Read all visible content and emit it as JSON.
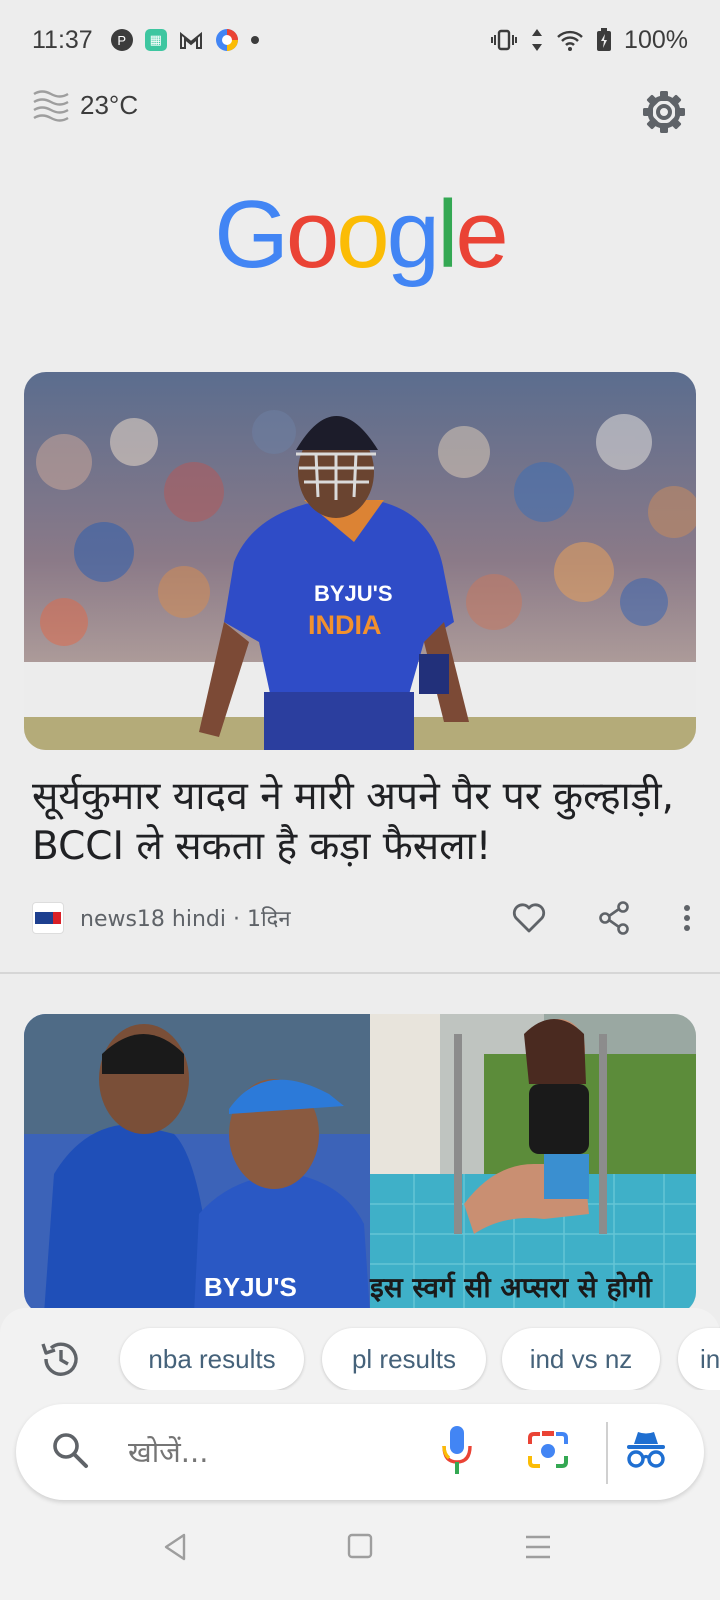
{
  "status_bar": {
    "time": "11:37",
    "battery": "100%"
  },
  "weather": {
    "temperature": "23°C"
  },
  "logo": {
    "letters": [
      "G",
      "o",
      "o",
      "g",
      "l",
      "e"
    ],
    "colors": [
      "#4285F4",
      "#EA4335",
      "#FBBC05",
      "#4285F4",
      "#34A853",
      "#EA4335"
    ]
  },
  "feed": {
    "card1": {
      "headline": "सूर्यकुमार यादव ने मारी अपने पैर पर कुल्हाड़ी, BCCI ले सकता है कड़ा फैसला!",
      "source": "news18 hindi · 1दिन",
      "image_text": {
        "jersey_sponsor": "BYJU'S",
        "jersey_country": "INDIA"
      }
    },
    "card2": {
      "caption": "इस स्वर्ग सी अप्सरा से होगी",
      "image_text": {
        "jersey_sponsor": "BYJU'S"
      }
    }
  },
  "suggestions": [
    "nba results",
    "pl results",
    "ind vs nz",
    "in"
  ],
  "search": {
    "placeholder": "खोजें..."
  }
}
